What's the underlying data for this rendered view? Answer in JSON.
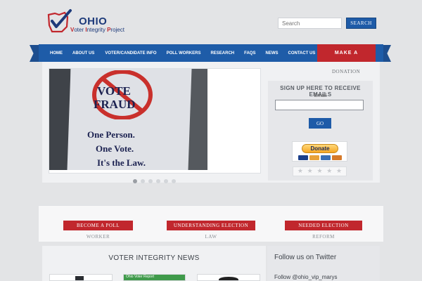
{
  "header": {
    "logo": {
      "title": "OHIO",
      "subtitle_parts": [
        "V",
        "oter ",
        "I",
        "ntegrity ",
        "P",
        "roject"
      ]
    },
    "search": {
      "placeholder": "Search",
      "button_label": "SEARCH"
    }
  },
  "nav": {
    "items": [
      "HOME",
      "ABOUT US",
      "VOTER/CANDIDATE INFO",
      "POLL WORKERS",
      "RESEARCH",
      "FAQS",
      "NEWS",
      "CONTACT US"
    ],
    "cta_label": "MAKE A",
    "cta_continuation": "DONATION"
  },
  "slider": {
    "sign_lines": [
      "VOTE",
      "FRAUD",
      "One Person.",
      "One Vote.",
      "It's the Law."
    ],
    "dot_count": 6,
    "active_dot": 0
  },
  "signup": {
    "title": "SIGN UP HERE TO RECEIVE EMAILS",
    "email_label": "Email",
    "go_label": "GO"
  },
  "paypal": {
    "donate_label": "Donate"
  },
  "rating": {
    "stars": 5,
    "filled": 0
  },
  "quick_links": [
    {
      "label": "BECOME A POLL",
      "continuation": "WORKER"
    },
    {
      "label": "UNDERSTANDING ELECTION",
      "continuation": "LAW"
    },
    {
      "label": "NEEDED ELECTION",
      "continuation": "REFORM"
    }
  ],
  "news": {
    "title": "VOTER INTEGRITY NEWS",
    "thumb_caption": "Ohio Voter Report"
  },
  "twitter": {
    "title": "Follow us on Twitter",
    "handle": "Follow @ohio_vip_marys"
  },
  "colors": {
    "brand_blue": "#1e5ca8",
    "brand_red": "#c1272d",
    "page_bg": "#e3e4e6"
  }
}
